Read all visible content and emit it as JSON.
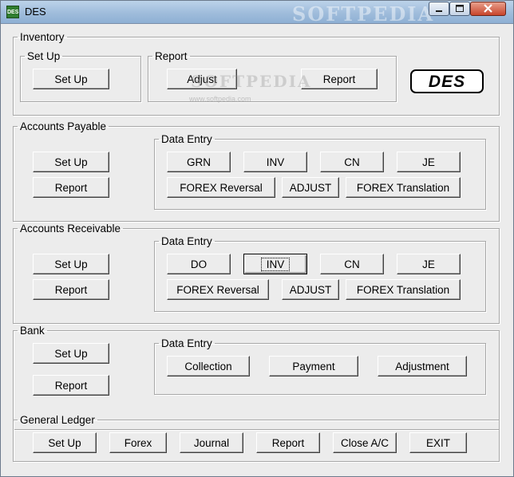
{
  "window": {
    "title": "DES",
    "icon_text": "DES",
    "watermark": "SOFTPEDIA",
    "controls": {
      "minimize": "minimize-icon",
      "maximize": "maximize-icon",
      "close": "close-icon"
    }
  },
  "inventory": {
    "title": "Inventory",
    "setup": {
      "title": "Set Up",
      "setup_label": "Set Up"
    },
    "report": {
      "title": "Report",
      "adjust_label": "Adjust",
      "report_label": "Report"
    },
    "logo_text": "DES",
    "watermark": "SOFTPEDIA",
    "watermark_url": "www.softpedia.com"
  },
  "accounts_payable": {
    "title": "Accounts Payable",
    "setup_label": "Set Up",
    "report_label": "Report",
    "data_entry": {
      "title": "Data Entry",
      "row1": [
        "GRN",
        "INV",
        "CN",
        "JE"
      ],
      "row2": [
        "FOREX Reversal",
        "ADJUST",
        "FOREX Translation"
      ]
    }
  },
  "accounts_receivable": {
    "title": "Accounts Receivable",
    "setup_label": "Set Up",
    "report_label": "Report",
    "data_entry": {
      "title": "Data Entry",
      "row1": [
        "DO",
        "INV",
        "CN",
        "JE"
      ],
      "row2": [
        "FOREX Reversal",
        "ADJUST",
        "FOREX Translation"
      ]
    }
  },
  "bank": {
    "title": "Bank",
    "setup_label": "Set Up",
    "report_label": "Report",
    "data_entry": {
      "title": "Data Entry",
      "buttons": [
        "Collection",
        "Payment",
        "Adjustment"
      ]
    }
  },
  "general_ledger": {
    "title": "General Ledger",
    "buttons": [
      "Set Up",
      "Forex",
      "Journal",
      "Report",
      "Close A/C",
      "EXIT"
    ]
  }
}
